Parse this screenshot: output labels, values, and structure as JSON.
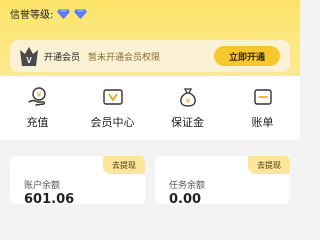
{
  "header": {
    "credit_label": "信誉等级:"
  },
  "vip": {
    "title": "开通会员",
    "desc": "暂未开通会员权限",
    "button": "立即开通"
  },
  "menu": {
    "items": [
      {
        "label": "充值",
        "icon": "recharge-icon"
      },
      {
        "label": "会员中心",
        "icon": "member-center-icon"
      },
      {
        "label": "保证金",
        "icon": "deposit-icon"
      },
      {
        "label": "账单",
        "icon": "bill-icon"
      }
    ]
  },
  "accounts": {
    "left": {
      "label": "账户余额",
      "value": "601.06",
      "action": "去提现"
    },
    "right": {
      "label": "任务余额",
      "value": "0.00",
      "action": "去提现"
    }
  },
  "colors": {
    "accent": "#f7c82d",
    "header_bg": "#fce46a",
    "diamond": "#5b7cf0"
  }
}
